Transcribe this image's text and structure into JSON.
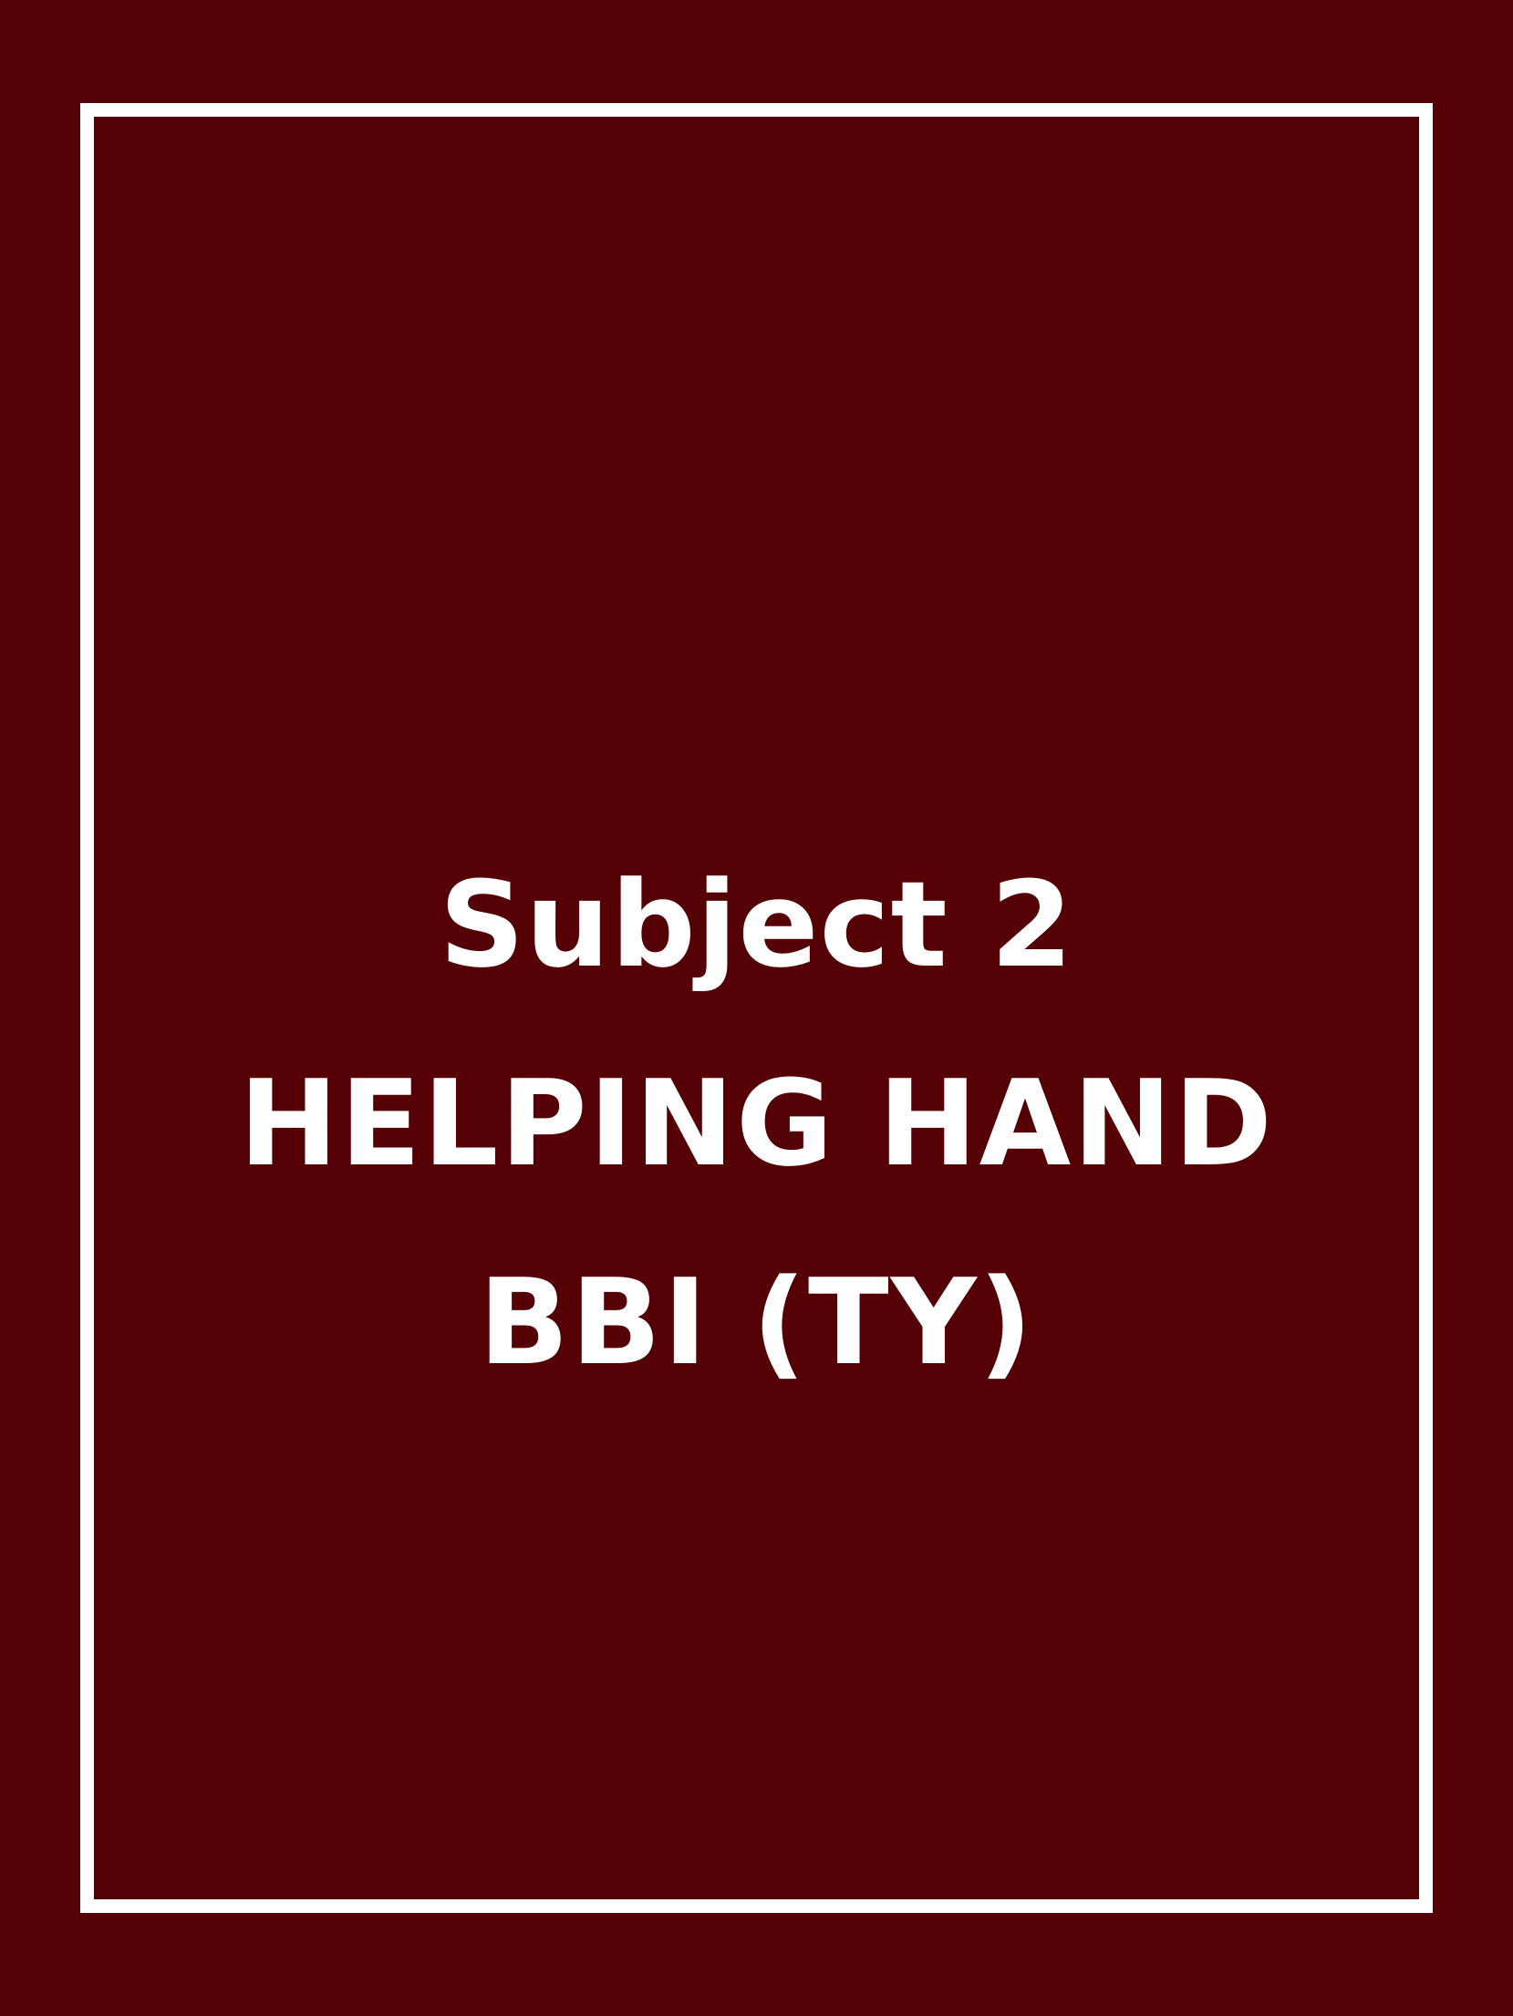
{
  "colors": {
    "background": "#540004",
    "frame": "#ffffff",
    "text": "#ffffff"
  },
  "cover": {
    "lines": [
      "Subject 2",
      "HELPING HAND",
      "BBI (TY)"
    ]
  }
}
